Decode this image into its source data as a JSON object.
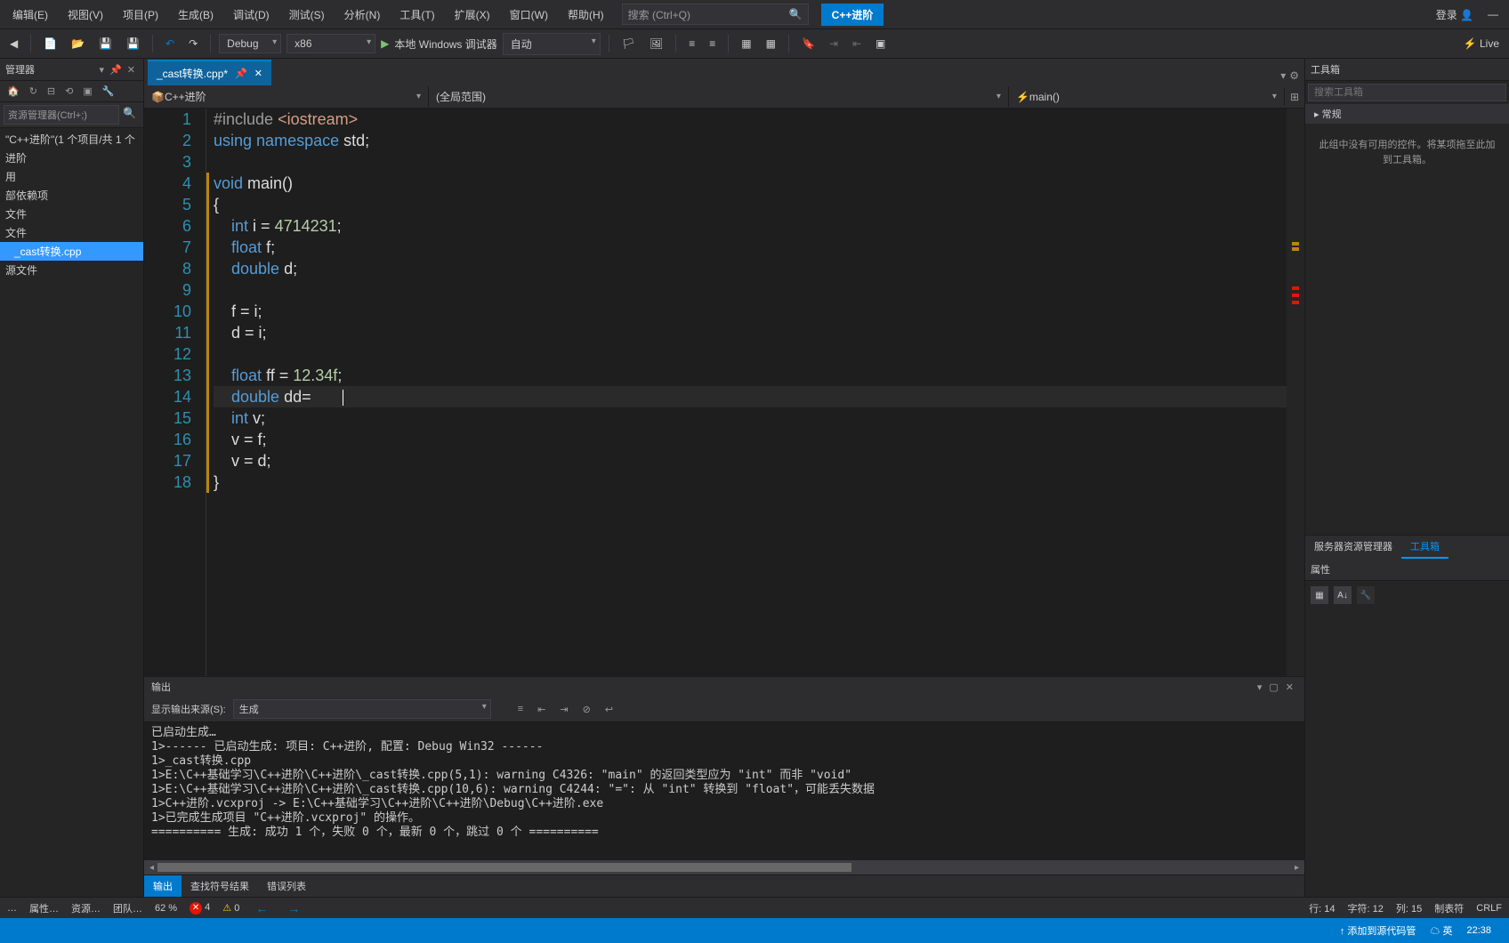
{
  "menu": {
    "items": [
      "编辑(E)",
      "视图(V)",
      "项目(P)",
      "生成(B)",
      "调试(D)",
      "测试(S)",
      "分析(N)",
      "工具(T)",
      "扩展(X)",
      "窗口(W)",
      "帮助(H)"
    ],
    "search_placeholder": "搜索 (Ctrl+Q)",
    "project_name": "C++进阶",
    "login": "登录"
  },
  "toolbar": {
    "config": "Debug",
    "platform": "x86",
    "debugger": "本地 Windows 调试器",
    "auto": "自动",
    "live": "Live"
  },
  "left": {
    "title": "管理器",
    "search_placeholder": "资源管理器(Ctrl+;)",
    "solution": "\"C++进阶\"(1 个项目/共 1 个",
    "tree": [
      "进阶",
      "用",
      "部依赖项",
      "文件",
      "文件",
      "_cast转换.cpp",
      "源文件"
    ]
  },
  "tabs": {
    "active": "_cast转换.cpp*"
  },
  "nav": {
    "project": "C++进阶",
    "scope": "(全局范围)",
    "func": "main()"
  },
  "code": {
    "lines": [
      {
        "n": 1,
        "html": "<span class='inc'>#include</span> <span class='str'>&lt;iostream&gt;</span>"
      },
      {
        "n": 2,
        "html": "<span class='kw'>using</span> <span class='kw'>namespace</span> <span class='txt'>std;</span>"
      },
      {
        "n": 3,
        "html": ""
      },
      {
        "n": 4,
        "html": "<span class='kw'>void</span> <span class='txt'>main()</span>"
      },
      {
        "n": 5,
        "html": "<span class='txt'>{</span>"
      },
      {
        "n": 6,
        "html": "    <span class='kw'>int</span> <span class='txt'>i = </span><span class='num'>4714231</span><span class='txt'>;</span>"
      },
      {
        "n": 7,
        "html": "    <span class='kw'>float</span> <span class='txt'>f;</span>"
      },
      {
        "n": 8,
        "html": "    <span class='kw'>double</span> <span class='txt'>d;</span>"
      },
      {
        "n": 9,
        "html": ""
      },
      {
        "n": 10,
        "html": "    <span class='txt'>f = i;</span>"
      },
      {
        "n": 11,
        "html": "    <span class='txt'>d = i;</span>"
      },
      {
        "n": 12,
        "html": ""
      },
      {
        "n": 13,
        "html": "    <span class='kw'>float</span> <span class='txt'>ff = </span><span class='num'>12.34f</span><span class='txt'>;</span>"
      },
      {
        "n": 14,
        "html": "    <span class='kw'>double</span> <span class='txt'>dd=</span>       <span class='caret'></span>",
        "current": true
      },
      {
        "n": 15,
        "html": "    <span class='kw'>int</span> <span class='txt'>v;</span>"
      },
      {
        "n": 16,
        "html": "    <span class='txt'>v = f;</span>"
      },
      {
        "n": 17,
        "html": "    <span class='txt'>v = d;</span>"
      },
      {
        "n": 18,
        "html": "<span class='txt'>}</span>"
      }
    ]
  },
  "output": {
    "title": "输出",
    "source_label": "显示输出来源(S):",
    "source": "生成",
    "lines": [
      "已启动生成…",
      "1>------ 已启动生成: 项目: C++进阶, 配置: Debug Win32 ------",
      "1>_cast转换.cpp",
      "1>E:\\C++基础学习\\C++进阶\\C++进阶\\_cast转换.cpp(5,1): warning C4326: \"main\" 的返回类型应为 \"int\" 而非 \"void\"",
      "1>E:\\C++基础学习\\C++进阶\\C++进阶\\_cast转换.cpp(10,6): warning C4244: \"=\": 从 \"int\" 转换到 \"float\"，可能丢失数据",
      "1>C++进阶.vcxproj -> E:\\C++基础学习\\C++进阶\\C++进阶\\Debug\\C++进阶.exe",
      "1>已完成生成项目 \"C++进阶.vcxproj\" 的操作。",
      "========== 生成: 成功 1 个，失败 0 个，最新 0 个，跳过 0 个 =========="
    ],
    "tabs": [
      "输出",
      "查找符号结果",
      "错误列表"
    ]
  },
  "right": {
    "toolbox": "工具箱",
    "toolbox_search": "搜索工具箱",
    "general": "常规",
    "empty": "此组中没有可用的控件。将某项拖至此加到工具箱。",
    "tabs": [
      "服务器资源管理器",
      "工具箱"
    ],
    "props": "属性"
  },
  "status": {
    "left_tabs": [
      "…",
      "属性…",
      "资源…",
      "团队…"
    ],
    "zoom": "62 %",
    "errors": "4",
    "warnings": "0",
    "line": "行: 14",
    "char": "字符: 12",
    "col": "列: 15",
    "tabmode": "制表符",
    "eol": "CRLF",
    "add_source": "添加到源代码管",
    "ime": "英",
    "time": "22:38"
  }
}
